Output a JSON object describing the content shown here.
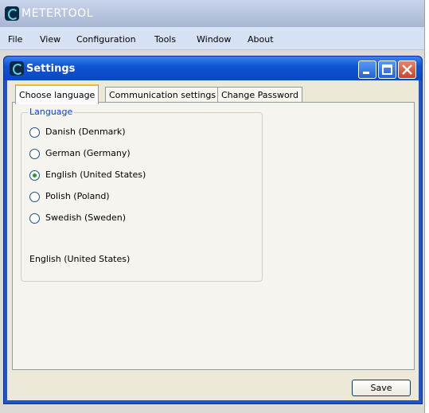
{
  "app": {
    "title": "METERTOOL",
    "logo_icon": "metertool-logo-icon"
  },
  "menu": {
    "items": [
      {
        "label": "File"
      },
      {
        "label": "View"
      },
      {
        "label": "Configuration"
      },
      {
        "label": "Tools"
      },
      {
        "label": "Window"
      },
      {
        "label": "About"
      }
    ]
  },
  "settings_window": {
    "title": "Settings",
    "controls": [
      "minimize-icon",
      "maximize-icon",
      "close-icon"
    ],
    "colors": {
      "titlebar": "#0e54d6",
      "close": "#c9442a",
      "active_tab_accent": "#f4b43a",
      "radio_dot": "#21a121"
    },
    "tabs": [
      {
        "label": "Choose language",
        "active": true
      },
      {
        "label": "Communication settings",
        "active": false
      },
      {
        "label": "Change Password",
        "active": false
      }
    ],
    "language_group": {
      "legend": "Language",
      "options": [
        {
          "label": "Danish (Denmark)",
          "checked": false
        },
        {
          "label": "German (Germany)",
          "checked": false
        },
        {
          "label": "English (United States)",
          "checked": true
        },
        {
          "label": "Polish (Poland)",
          "checked": false
        },
        {
          "label": "Swedish (Sweden)",
          "checked": false
        }
      ],
      "selected_text": "English (United States)"
    },
    "save_label": "Save"
  }
}
